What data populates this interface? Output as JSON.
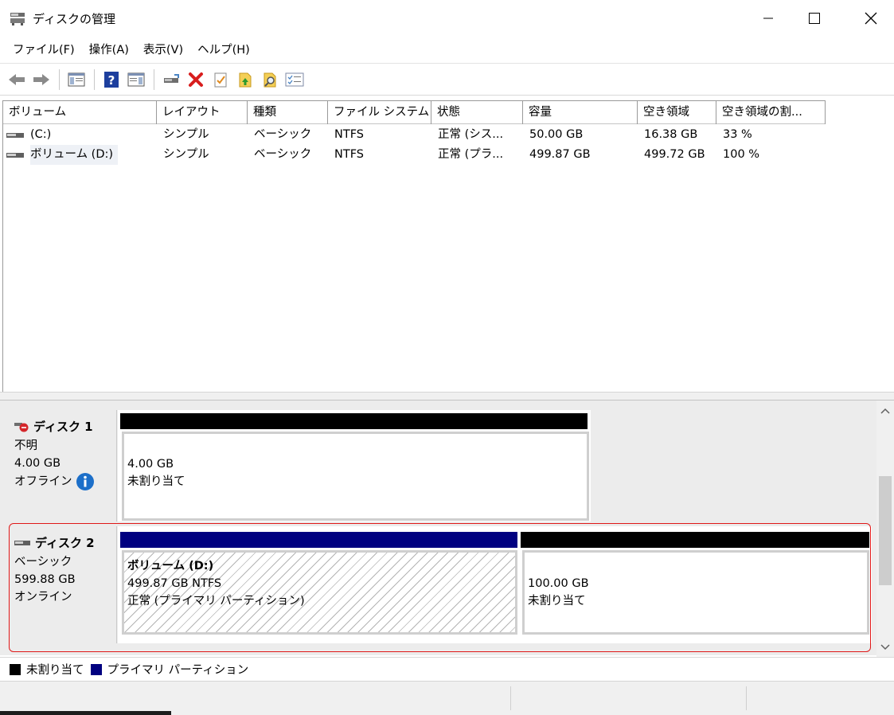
{
  "window": {
    "title": "ディスクの管理",
    "icon": "disk-management-icon"
  },
  "menu": {
    "items": [
      "ファイル(F)",
      "操作(A)",
      "表示(V)",
      "ヘルプ(H)"
    ]
  },
  "toolbar": {
    "buttons": [
      "back-arrow-icon",
      "forward-arrow-icon",
      "console-tree-icon",
      "help-icon",
      "action-pane-icon",
      "connect-drive-icon",
      "delete-icon",
      "properties-icon",
      "rescan-icon",
      "search-icon",
      "settings-list-icon"
    ]
  },
  "volume_list": {
    "columns": [
      "ボリューム",
      "レイアウト",
      "種類",
      "ファイル システム",
      "状態",
      "容量",
      "空き領域",
      "空き領域の割..."
    ],
    "rows": [
      {
        "volume": "(C:)",
        "layout": "シンプル",
        "type": "ベーシック",
        "fs": "NTFS",
        "status": "正常 (シス...",
        "capacity": "50.00 GB",
        "free": "16.38 GB",
        "free_pct": "33 %"
      },
      {
        "volume": "ボリューム (D:)",
        "layout": "シンプル",
        "type": "ベーシック",
        "fs": "NTFS",
        "status": "正常 (プラ...",
        "capacity": "499.87 GB",
        "free": "499.72 GB",
        "free_pct": "100 %"
      }
    ]
  },
  "disks": [
    {
      "name": "ディスク 1",
      "type": "不明",
      "size": "4.00 GB",
      "state": "オフライン",
      "partitions": [
        {
          "size": "4.00 GB",
          "desc": "未割り当て"
        }
      ]
    },
    {
      "name": "ディスク 2",
      "type": "ベーシック",
      "size": "599.88 GB",
      "state": "オンライン",
      "partitions": [
        {
          "title": "ボリューム (D:)",
          "size": "499.87 GB NTFS",
          "desc": "正常 (プライマリ パーティション)"
        },
        {
          "size": "100.00 GB",
          "desc": "未割り当て"
        }
      ]
    }
  ],
  "legend": {
    "items": [
      {
        "label": "未割り当て",
        "color": "#000000"
      },
      {
        "label": "プライマリ パーティション",
        "color": "#000080"
      }
    ]
  },
  "colors": {
    "unallocated": "#000000",
    "primary_partition": "#000080",
    "highlight": "#e01818",
    "info": "#1c6fc9",
    "offline_badge": "#d4262b"
  }
}
